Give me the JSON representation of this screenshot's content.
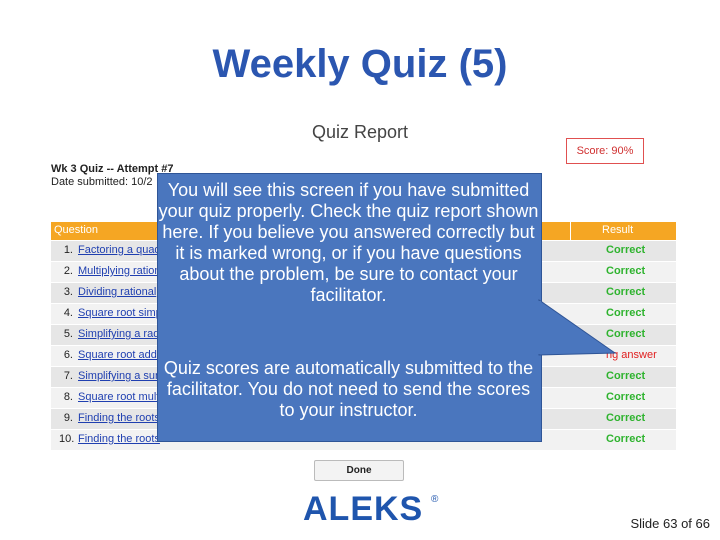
{
  "slide": {
    "title": "Weekly Quiz (5)",
    "slide_number": "Slide 63 of 66"
  },
  "report": {
    "title": "Quiz Report",
    "score": "Score: 90%",
    "attempt_title": "Wk 3 Quiz -- Attempt #7",
    "date_label": "Date submitted: 10/2",
    "header_question": "Question",
    "header_result": "Result",
    "rows": [
      {
        "num": "1.",
        "question": "Factoring a quad",
        "result": "Correct",
        "wrong": false
      },
      {
        "num": "2.",
        "question": "Multiplying ration",
        "result": "Correct",
        "wrong": false
      },
      {
        "num": "3.",
        "question": "Dividing rational",
        "result": "Correct",
        "wrong": false
      },
      {
        "num": "4.",
        "question": "Square root simp",
        "result": "Correct",
        "wrong": false
      },
      {
        "num": "5.",
        "question": "Simplifying a rad",
        "result": "Correct",
        "wrong": false
      },
      {
        "num": "6.",
        "question": "Square root addi",
        "result": "ng answer",
        "wrong": true
      },
      {
        "num": "7.",
        "question": "Simplifying a sun",
        "result": "Correct",
        "wrong": false
      },
      {
        "num": "8.",
        "question": "Square root multi",
        "result": "Correct",
        "wrong": false
      },
      {
        "num": "9.",
        "question": "Finding the roots",
        "result": "Correct",
        "wrong": false
      },
      {
        "num": "10.",
        "question": "Finding the roots",
        "result": "Correct",
        "wrong": false
      }
    ],
    "done_label": "Done"
  },
  "callout": {
    "paragraph1": "You will see this screen if you have submitted your quiz properly. Check the quiz report shown here. If you believe you answered correctly but it is marked wrong, or if you have questions about the problem, be sure to contact your facilitator.",
    "paragraph2": "Quiz scores are automatically submitted to the facilitator. You do not need to send the scores to your instructor."
  },
  "logo": {
    "text": "ALEKS",
    "mark": "®"
  },
  "colors": {
    "title": "#2b56b0",
    "callout": "#4a76be",
    "header": "#f5a623",
    "correct": "#2fb32f",
    "wrong": "#e02020"
  }
}
